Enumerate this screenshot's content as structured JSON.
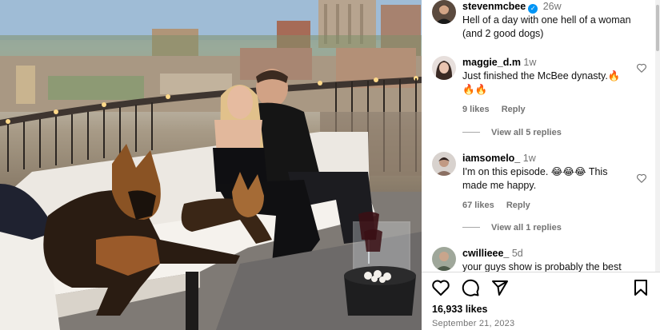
{
  "post": {
    "author": "stevenmcbee",
    "time": "26w",
    "caption": "Hell of a day with one hell of a woman (and 2 good dogs)"
  },
  "comments": [
    {
      "username": "maggie_d.m",
      "time": "1w",
      "text": "Just finished the McBee dynasty.🔥🔥🔥",
      "likes": "9 likes",
      "reply_label": "Reply",
      "view_replies": "View all 5 replies"
    },
    {
      "username": "iamsomelo_",
      "time": "1w",
      "text": "I'm on this episode. 😂😂😂 This made me happy.",
      "likes": "67 likes",
      "reply_label": "Reply",
      "view_replies": "View all 1 replies"
    },
    {
      "username": "cwillieee_",
      "time": "5d",
      "text": "your guys show is probably the best"
    }
  ],
  "footer": {
    "likes": "16,933 likes",
    "date": "September 21, 2023"
  },
  "icons": {
    "verified": "verified-badge-icon",
    "like": "heart-icon",
    "comment": "comment-icon",
    "share": "share-icon",
    "save": "bookmark-icon"
  },
  "colors": {
    "verified": "#0095f6",
    "secondary_text": "#737373",
    "divider": "#dbdbdb"
  }
}
